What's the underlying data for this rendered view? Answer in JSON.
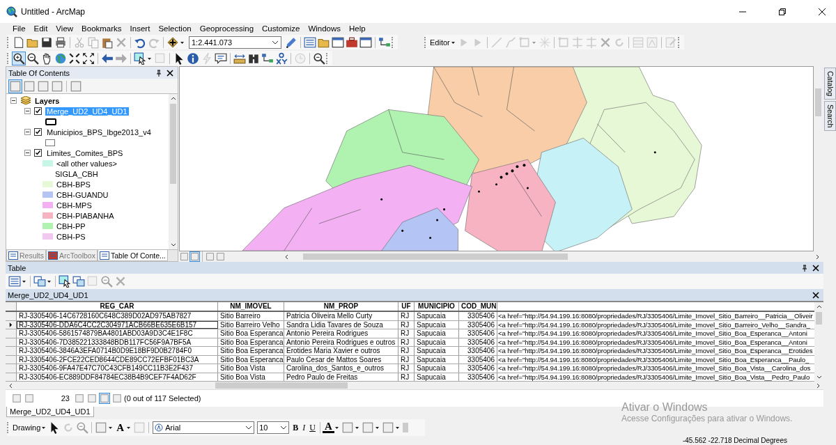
{
  "window": {
    "title": "Untitled - ArcMap"
  },
  "menu": [
    "File",
    "Edit",
    "View",
    "Bookmarks",
    "Insert",
    "Selection",
    "Geoprocessing",
    "Customize",
    "Windows",
    "Help"
  ],
  "standard_toolbar": {
    "scale": "1:2.441.073"
  },
  "editor_toolbar": {
    "label": "Editor"
  },
  "table_of_contents": {
    "title": "Table Of Contents",
    "root": {
      "label": "Layers",
      "expanded": true
    },
    "layers": [
      {
        "label": "Merge_UD2_UD4_UD1",
        "checked": true,
        "selected": true,
        "expanded": true,
        "legend": [
          {
            "kind": "bold-outline"
          }
        ]
      },
      {
        "label": "Municipios_BPS_Ibge2013_v4",
        "checked": true,
        "selected": false,
        "expanded": true,
        "legend": [
          {
            "kind": "outline"
          }
        ]
      },
      {
        "label": "Limites_Comites_BPS",
        "checked": true,
        "selected": false,
        "expanded": true,
        "legend": [
          {
            "kind": "swatch",
            "label": "<all other values>",
            "color": "#c6f7e6"
          },
          {
            "kind": "field",
            "label": "SIGLA_CBH"
          },
          {
            "kind": "swatch",
            "label": "CBH-BPS",
            "color": "#e7f8d6"
          },
          {
            "kind": "swatch",
            "label": "CBH-GUANDU",
            "color": "#b3c4f5"
          },
          {
            "kind": "swatch",
            "label": "CBH-MPS",
            "color": "#f3b0f3"
          },
          {
            "kind": "swatch",
            "label": "CBH-PIABANHA",
            "color": "#f7b3c1"
          },
          {
            "kind": "swatch",
            "label": "CBH-PP",
            "color": "#b0f3b0"
          },
          {
            "kind": "swatch",
            "label": "CBH-PS",
            "color": "#f0c8f0"
          }
        ]
      }
    ],
    "tabs": [
      {
        "label": "Results",
        "selected": false
      },
      {
        "label": "ArcToolbox",
        "selected": false
      },
      {
        "label": "Table Of Conte...",
        "selected": true
      }
    ]
  },
  "right_dock": [
    "Catalog",
    "Search"
  ],
  "table": {
    "title": "Table",
    "layer_tab": "Merge_UD2_UD4_UD1",
    "columns": [
      "REG_CAR",
      "NM_IMOVEL",
      "NM_PROP",
      "UF",
      "MUNICIPIO",
      "COD_MUN"
    ],
    "rows": [
      {
        "current": false,
        "cells": [
          "RJ-3305406-14C6728160C648C389D02AD975AB7827",
          "Sitio Barreiro",
          "Patricia  Oliveira Mello Curty",
          "RJ",
          "Sapucaia",
          "3305406",
          "<a href=\"http://54.94.199.16:8080/propriedades/RJ/3305406/Limite_Imovel_Sitio_Barreiro__Patricia__Oliveir"
        ]
      },
      {
        "current": true,
        "cells": [
          "RJ-3305406-DDA6C4CC2C304971ACB66BE635E6B157",
          "Sitio Barreiro Velho",
          "Sandra Lidia Tavares de Souza",
          "RJ",
          "Sapucaia",
          "3305406",
          "<a href=\"http://54.94.199.16:8080/propriedades/RJ/3305406/Limite_Imovel_Sitio_Barreiro_Velho__Sandra_"
        ]
      },
      {
        "current": false,
        "cells": [
          "RJ-3305406-5861574879BA4801ABD03A9D3C4E1F8C",
          "Sitio Boa Esperanca",
          "Antonio Pereira Rodrigues",
          "RJ",
          "Sapucaia",
          "3305406",
          "<a href=\"http://54.94.199.16:8080/propriedades/RJ/3305406/Limite_Imovel_Sitio_Boa_Esperanca__Antoni"
        ]
      },
      {
        "current": false,
        "cells": [
          "RJ-3305406-7D385221333848BDB117FC56F9A7BF5A",
          "Sitio Boa Esperanca",
          "Antonio Pereira Rodrigues e outros",
          "RJ",
          "Sapucaia",
          "3305406",
          "<a href=\"http://54.94.199.16:8080/propriedades/RJ/3305406/Limite_Imovel_Sitio_Boa_Esperanca__Antoni"
        ]
      },
      {
        "current": false,
        "cells": [
          "RJ-3305406-3846A3EFA0714B0D9E18BF9D0B2784F0",
          "Sitio Boa Esperanca",
          "Erotides Maria Xavier e outros",
          "RJ",
          "Sapucaia",
          "3305406",
          "<a href=\"http://54.94.199.16:8080/propriedades/RJ/3305406/Limite_Imovel_Sitio_Boa_Esperanca__Erotides"
        ]
      },
      {
        "current": false,
        "cells": [
          "RJ-3305406-2FCE22CED8644CDE89CC72EFBF01BC3A",
          "Sitio Boa Esperanca",
          "Paulo Cesar de Mattos Soares",
          "RJ",
          "Sapucaia",
          "3305406",
          "<a href=\"http://54.94.199.16:8080/propriedades/RJ/3305406/Limite_Imovel_Sitio_Boa_Esperanca__Paulo_"
        ]
      },
      {
        "current": false,
        "cells": [
          "RJ-3305406-9FA47E47C70C43CFB149CC11B3E2F437",
          "Sitio Boa Vista",
          "Carolina_dos_Santos_e_outros",
          "RJ",
          "Sapucaia",
          "3305406",
          "<a href=\"http://54.94.199.16:8080/propriedades/RJ/3305406/Limite_Imovel_Sitio_Boa_Vista__Carolina_dos"
        ]
      },
      {
        "current": false,
        "cells": [
          "RJ-3305406-EC889DDF84784EC38B4B9CEF7F4AD62F",
          "Sitio Boa Vista",
          "Pedro Paulo de Freitas",
          "RJ",
          "Sapucaia",
          "3305406",
          "<a href=\"http://54.94.199.16:8080/propriedades/RJ/3305406/Limite_Imovel_Sitio_Boa_Vista__Pedro_Paulo"
        ]
      }
    ],
    "record": "23",
    "selection_status": "(0 out of 117 Selected)"
  },
  "layout_tabs": [
    {
      "label": "Merge_UD2_UD4_UD1",
      "selected": true
    }
  ],
  "drawing_toolbar": {
    "label": "Drawing",
    "text_tool": "A",
    "font": "Arial",
    "size": "10",
    "styles": [
      "B",
      "I",
      "U"
    ],
    "font_color": "A"
  },
  "activation_notice": {
    "title": "Ativar o Windows",
    "text": "Acesse Configurações para ativar o Windows."
  },
  "status_bar": {
    "coordinates": "-45.562  -22.718 Decimal Degrees"
  }
}
